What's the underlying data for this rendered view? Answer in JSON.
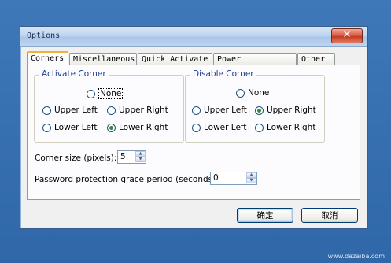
{
  "window": {
    "title": "Options",
    "close_glyph": "✕"
  },
  "tabs": [
    {
      "label": "Corners",
      "active": true
    },
    {
      "label": "Miscellaneous",
      "active": false
    },
    {
      "label": "Quick Activate",
      "active": false
    },
    {
      "label": "Power Management",
      "active": false
    },
    {
      "label": "Other",
      "active": false
    }
  ],
  "activate_group": {
    "legend": "Activate Corner",
    "none": "None",
    "upper_left": "Upper Left",
    "upper_right": "Upper Right",
    "lower_left": "Lower Left",
    "lower_right": "Lower Right",
    "selected": "lower_right"
  },
  "disable_group": {
    "legend": "Disable Corner",
    "none": "None",
    "upper_left": "Upper Left",
    "upper_right": "Upper Right",
    "lower_left": "Lower Left",
    "lower_right": "Lower Right",
    "selected": "upper_right"
  },
  "corner_size": {
    "label": "Corner size (pixels):",
    "value": "5"
  },
  "grace_period": {
    "label": "Password protection grace period (seconds):",
    "value": "0"
  },
  "buttons": {
    "ok": "确定",
    "cancel": "取消"
  },
  "watermark": "www.dazaiba.com"
}
